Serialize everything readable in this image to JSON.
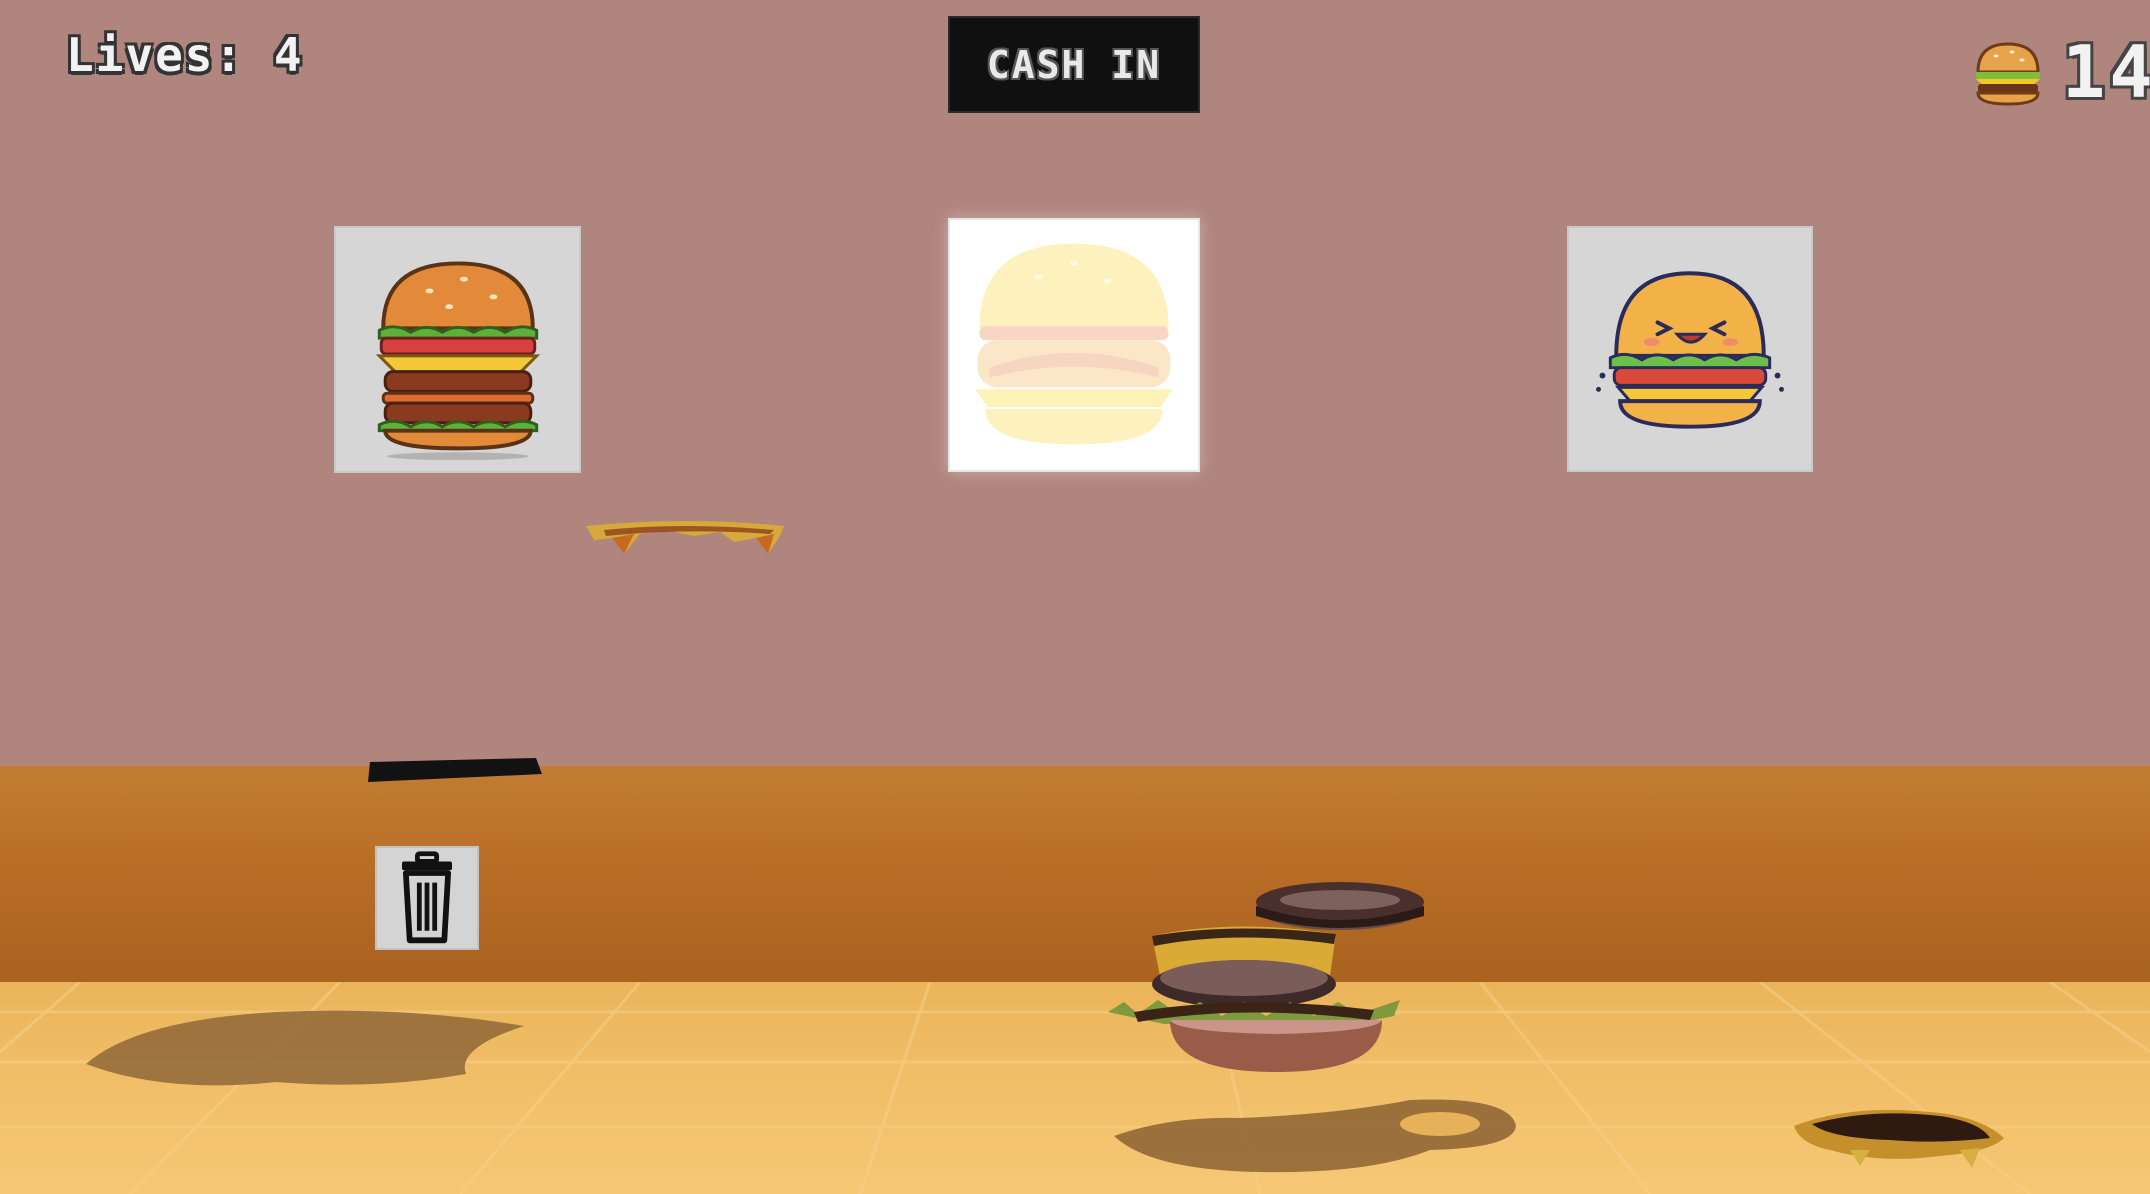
{
  "hud": {
    "lives_label": "Lives: 4",
    "score_value": "14",
    "score_icon": "burger-icon"
  },
  "cash_in_button": {
    "label": "CASH IN"
  },
  "orders": [
    {
      "name": "double-cheeseburger",
      "icon": "double-burger-icon",
      "state": "pending"
    },
    {
      "name": "plain-burger",
      "icon": "burger-icon",
      "state": "highlighted"
    },
    {
      "name": "happy-burger",
      "icon": "smiling-burger-icon",
      "state": "pending"
    }
  ],
  "trash_bin": {
    "icon": "trash-icon"
  },
  "colors": {
    "wall": "#b0857d",
    "counter": "#b96e26",
    "floor": "#f0bd66",
    "button_bg": "#101010"
  }
}
